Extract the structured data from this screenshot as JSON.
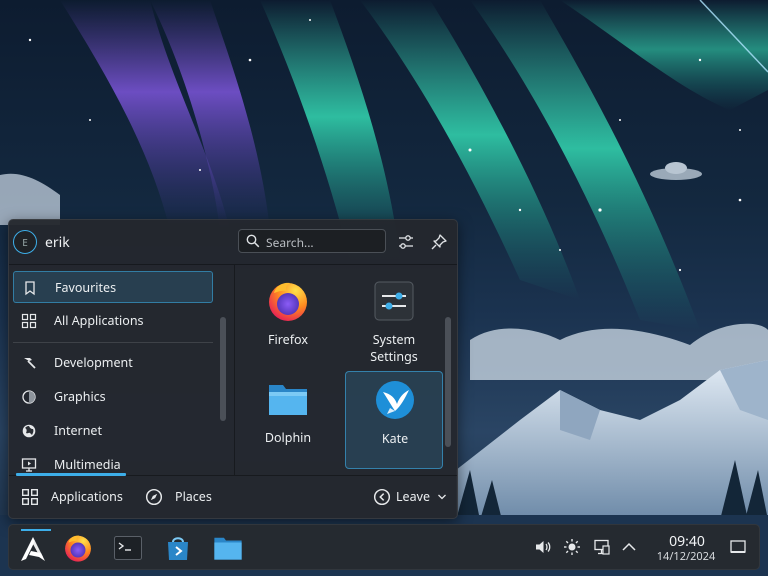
{
  "user": {
    "name": "erik",
    "avatar_initial": "E"
  },
  "search": {
    "placeholder": "Search..."
  },
  "categories": [
    {
      "label": "Favourites",
      "icon": "bookmark-icon",
      "selected": true
    },
    {
      "label": "All Applications",
      "icon": "grid-icon",
      "selected": false
    },
    {
      "label": "Development",
      "icon": "hammer-icon",
      "selected": false
    },
    {
      "label": "Graphics",
      "icon": "graphics-icon",
      "selected": false
    },
    {
      "label": "Internet",
      "icon": "globe-icon",
      "selected": false
    },
    {
      "label": "Multimedia",
      "icon": "monitor-icon",
      "selected": false
    }
  ],
  "apps": [
    {
      "label": "Firefox",
      "icon": "firefox-icon",
      "selected": false
    },
    {
      "label": "System\nSettings",
      "icon": "system-settings-icon",
      "selected": false
    },
    {
      "label": "Dolphin",
      "icon": "folder-icon",
      "selected": false
    },
    {
      "label": "Kate",
      "icon": "kate-icon",
      "selected": true
    }
  ],
  "footer": {
    "applications_label": "Applications",
    "places_label": "Places",
    "leave_label": "Leave"
  },
  "taskbar": {
    "launcher_icon": "application-launcher-icon",
    "pinned": [
      "firefox-icon",
      "terminal-icon",
      "discover-icon",
      "folder-icon"
    ],
    "tray": [
      "volume-icon",
      "brightness-icon",
      "network-icon",
      "chevron-up-icon"
    ],
    "clock": {
      "time": "09:40",
      "date": "14/12/2024"
    }
  },
  "colors": {
    "accent": "#3daee9",
    "panel": "#24282e"
  }
}
